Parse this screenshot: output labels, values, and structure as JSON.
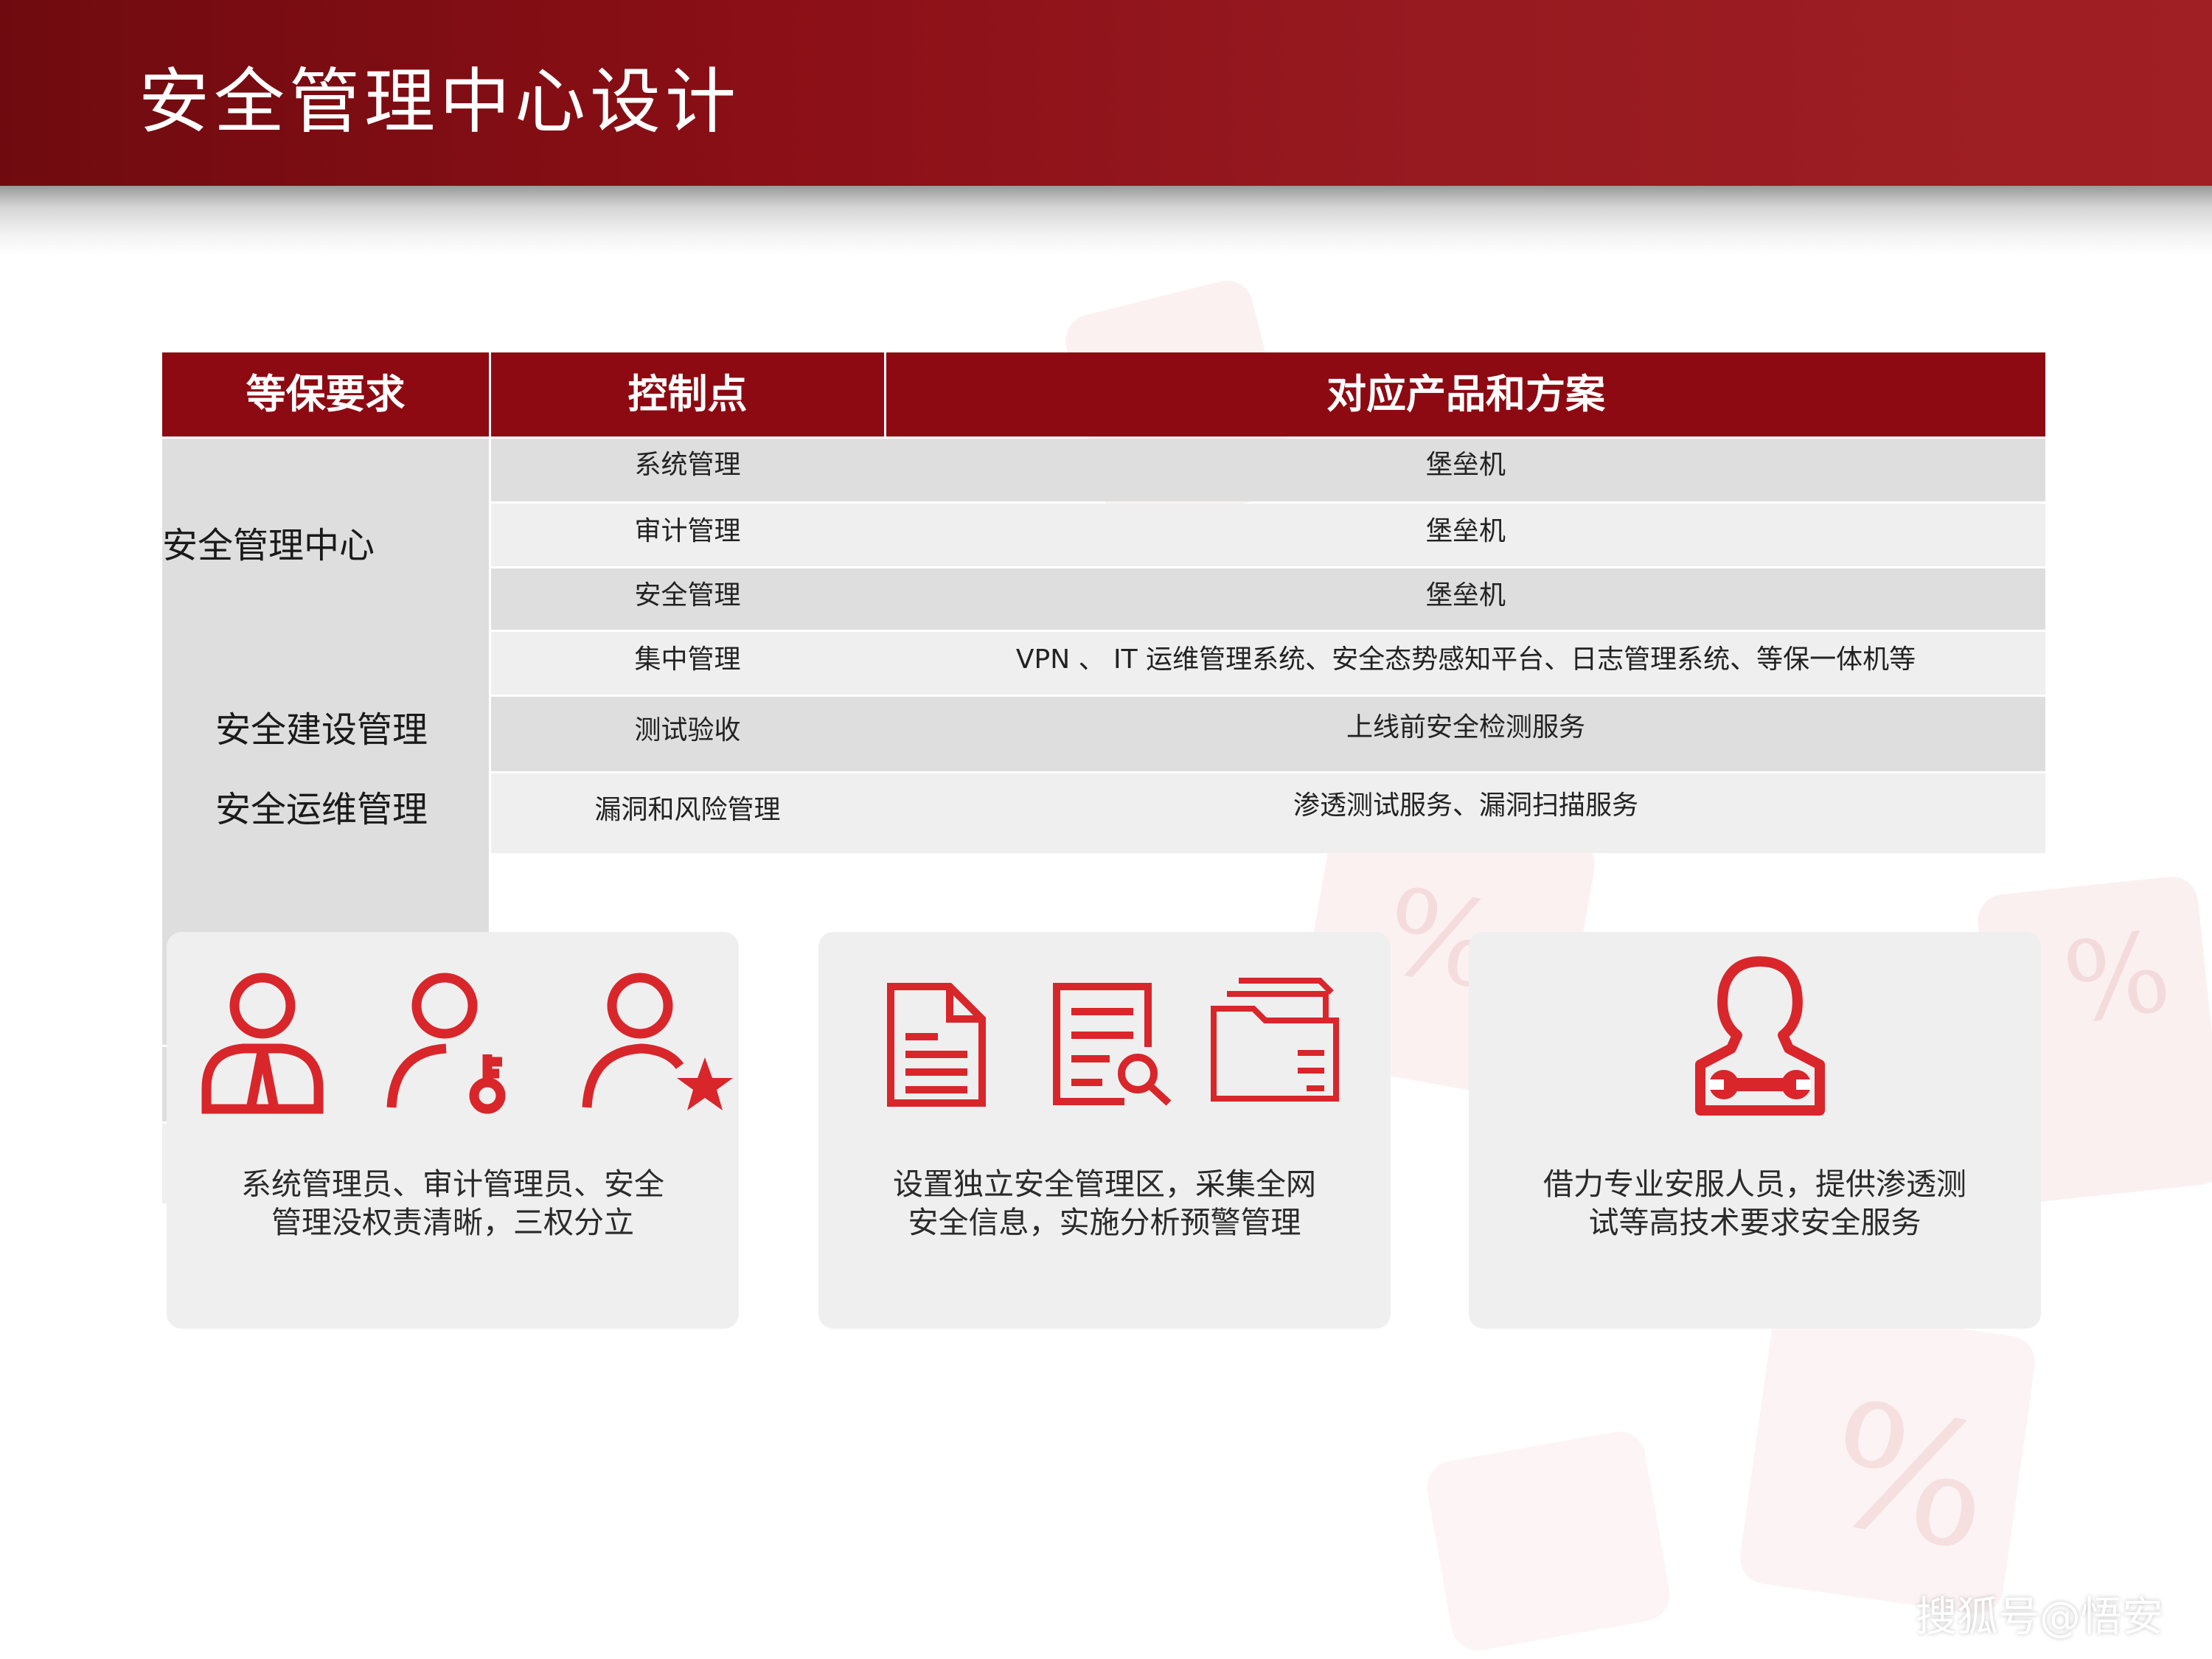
{
  "title": "安全管理中心设计",
  "table": {
    "headers": [
      "等保要求",
      "控制点",
      "对应产品和方案"
    ],
    "groups": [
      {
        "requirement": "安全管理中心",
        "rows": [
          {
            "control": "系统管理",
            "solution": "堡垒机"
          },
          {
            "control": "审计管理",
            "solution": "堡垒机"
          },
          {
            "control": "安全管理",
            "solution": "堡垒机"
          },
          {
            "control": "集中管理",
            "solution": "VPN 、 IT 运维管理系统、安全态势感知平台、日志管理系统、等保一体机等"
          }
        ]
      },
      {
        "requirement": "安全建设管理",
        "rows": [
          {
            "control": "测试验收",
            "solution": "上线前安全检测服务"
          }
        ]
      },
      {
        "requirement": "安全运维管理",
        "rows": [
          {
            "control": "漏洞和风险管理",
            "solution": "渗透测试服务、漏洞扫描服务"
          }
        ]
      }
    ]
  },
  "cards": [
    {
      "icons": [
        "admin-person-icon",
        "key-person-icon",
        "star-person-icon"
      ],
      "text_line1": "系统管理员、审计管理员、安全",
      "text_line2": "管理没权责清晰，三权分立"
    },
    {
      "icons": [
        "document-icon",
        "document-search-icon",
        "folder-files-icon"
      ],
      "text_line1": "设置独立安全管理区，采集全网",
      "text_line2": "安全信息，实施分析预警管理"
    },
    {
      "icons": [
        "engineer-wrench-icon"
      ],
      "text_line1": "借力专业安服人员，提供渗透测",
      "text_line2": "试等高技术要求安全服务"
    }
  ],
  "watermark": "搜狐号@悟安",
  "colors": {
    "header_red": "#8b0f16",
    "table_header": "#8d0a12",
    "icon_red": "#d8262b",
    "row_dark": "#dedede",
    "row_light": "#efefef",
    "card_bg": "#efefef"
  }
}
